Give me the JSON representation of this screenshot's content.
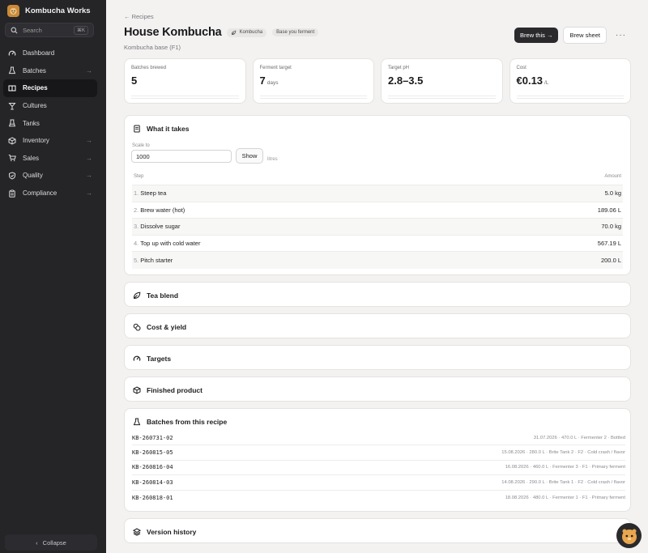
{
  "app": {
    "name": "Kombucha Works"
  },
  "search": {
    "placeholder": "Search",
    "shortcut": "⌘K"
  },
  "sidebar": {
    "items": [
      {
        "label": "Dashboard",
        "icon": "gauge-icon",
        "chevron": false,
        "active": false
      },
      {
        "label": "Batches",
        "icon": "flask-icon",
        "chevron": true,
        "active": false
      },
      {
        "label": "Recipes",
        "icon": "book-icon",
        "chevron": false,
        "active": true
      },
      {
        "label": "Cultures",
        "icon": "culture-icon",
        "chevron": false,
        "active": false
      },
      {
        "label": "Tanks",
        "icon": "tank-icon",
        "chevron": false,
        "active": false
      },
      {
        "label": "Inventory",
        "icon": "box-icon",
        "chevron": true,
        "active": false
      },
      {
        "label": "Sales",
        "icon": "cart-icon",
        "chevron": true,
        "active": false
      },
      {
        "label": "Quality",
        "icon": "shield-icon",
        "chevron": true,
        "active": false
      },
      {
        "label": "Compliance",
        "icon": "clipboard-icon",
        "chevron": true,
        "active": false
      }
    ],
    "collapse_label": "Collapse"
  },
  "header": {
    "breadcrumb": "← Recipes",
    "title": "House Kombucha",
    "tags": [
      "Kombucha",
      "Base you ferment"
    ],
    "subtitle": "Kombucha base (F1)",
    "brew_button": "Brew this →",
    "sheet_button": "Brew sheet",
    "more": "···"
  },
  "stats": [
    {
      "label": "Batches brewed",
      "value": "5",
      "unit": ""
    },
    {
      "label": "Ferment target",
      "value": "7",
      "unit": "days"
    },
    {
      "label": "Target pH",
      "value": "2.8–3.5",
      "unit": ""
    },
    {
      "label": "Cost",
      "value": "€0.13",
      "unit": "/L"
    }
  ],
  "what_it_takes": {
    "title": "What it takes",
    "scale_label": "Scale to",
    "scale_value": "1000",
    "show_button": "Show",
    "scale_unit": "litres",
    "columns": {
      "step": "Step",
      "amount": "Amount"
    },
    "steps": [
      {
        "n": "1.",
        "step": "Steep tea",
        "amount": "5.0 kg"
      },
      {
        "n": "2.",
        "step": "Brew water (hot)",
        "amount": "189.06 L"
      },
      {
        "n": "3.",
        "step": "Dissolve sugar",
        "amount": "70.0 kg"
      },
      {
        "n": "4.",
        "step": "Top up with cold water",
        "amount": "567.19 L"
      },
      {
        "n": "5.",
        "step": "Pitch starter",
        "amount": "200.0 L"
      }
    ]
  },
  "sections": {
    "tea_blend": "Tea blend",
    "cost_yield": "Cost & yield",
    "targets": "Targets",
    "finished_product": "Finished product",
    "batches": "Batches from this recipe",
    "version_history": "Version history"
  },
  "batches": [
    {
      "code": "KB-260731-02",
      "meta": "31.07.2026 · 470.0 L · Fermenter 2 · Bottled"
    },
    {
      "code": "KB-260815-05",
      "meta": "15.08.2026 · 280.0 L · Brite Tank 2 · F2 · Cold crash / flavor"
    },
    {
      "code": "KB-260816-04",
      "meta": "16.08.2026 · 460.0 L · Fermenter 3 · F1 · Primary ferment"
    },
    {
      "code": "KB-260814-03",
      "meta": "14.08.2026 · 290.0 L · Brite Tank 1 · F2 · Cold crash / flavor"
    },
    {
      "code": "KB-260818-01",
      "meta": "18.08.2026 · 480.0 L · Fermenter 1 · F1 · Primary ferment"
    }
  ]
}
